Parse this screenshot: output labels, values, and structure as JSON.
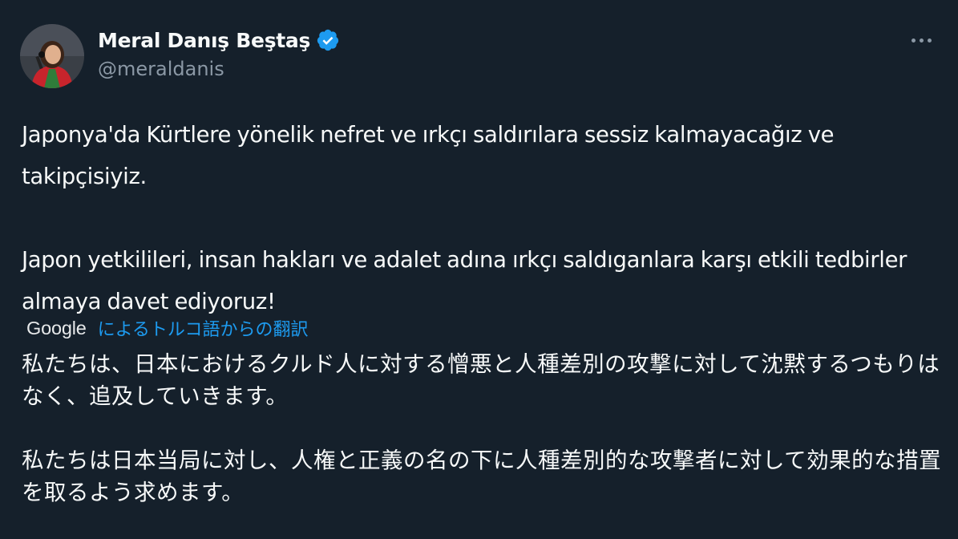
{
  "author": {
    "display_name": "Meral Danış Beştaş",
    "handle": "@meraldanis",
    "verified_icon": "verified-badge-icon",
    "avatar_icon": "profile-photo"
  },
  "menu": {
    "more_icon": "more-options-icon"
  },
  "tweet": {
    "paragraph_1": "Japonya'da Kürtlere yönelik nefret ve ırkçı saldırılara sessiz kalmayacağız ve takipçisiyiz.",
    "paragraph_2": "Japon yetkilileri, insan hakları ve adalet adına ırkçı saldıganlara karşı etkili tedbirler almaya davet ediyoruz!"
  },
  "translation": {
    "provider": "Google",
    "link_text": "によるトルコ語からの翻訳",
    "paragraph_1": "私たちは、日本におけるクルド人に対する憎悪と人種差別の攻撃に対して沈黙するつもりはなく、追及していきます。",
    "paragraph_2": "私たちは日本当局に対し、人権と正義の名の下に人種差別的な攻撃者に対して効果的な措置を取るよう求めます。"
  },
  "colors": {
    "background": "#15202b",
    "text_primary": "#f7f9f9",
    "text_secondary": "#8b98a5",
    "accent": "#1d9bf0"
  }
}
